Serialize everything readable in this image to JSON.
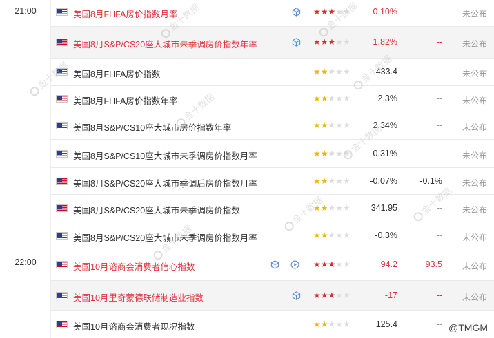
{
  "colors": {
    "highlight_red": "#e0303c",
    "star_red": "#d4302f",
    "star_yellow": "#e8b800",
    "star_off": "#dcdcdc",
    "row_border": "#e9e9e9",
    "shaded_row": "#f4f4f4"
  },
  "rows": [
    {
      "name": "美国8月FHFA房价指数月率",
      "importance": 3,
      "previous": "-0.10%",
      "forecast": "--",
      "actual": "未公布",
      "highlight": true,
      "icons": [
        "cube-icon"
      ]
    },
    {
      "name": "美国8月S&P/CS20座大城市未季调房价指数年率",
      "importance": 3,
      "previous": "1.82%",
      "forecast": "--",
      "actual": "未公布",
      "highlight": true,
      "icons": [
        "cube-icon"
      ]
    },
    {
      "name": "美国8月FHFA房价指数",
      "importance": 2,
      "previous": "433.4",
      "forecast": "--",
      "actual": "未公布",
      "highlight": false,
      "icons": []
    },
    {
      "name": "美国8月FHFA房价指数年率",
      "importance": 2,
      "previous": "2.3%",
      "forecast": "--",
      "actual": "未公布",
      "highlight": false,
      "icons": []
    },
    {
      "name": "美国8月S&P/CS10座大城市房价指数年率",
      "importance": 2,
      "previous": "2.34%",
      "forecast": "--",
      "actual": "未公布",
      "highlight": false,
      "icons": []
    },
    {
      "name": "美国8月S&P/CS10座大城市未季调房价指数月率",
      "importance": 2,
      "previous": "-0.31%",
      "forecast": "--",
      "actual": "未公布",
      "highlight": false,
      "icons": []
    },
    {
      "name": "美国8月S&P/CS20座大城市季调后房价指数月率",
      "importance": 2,
      "previous": "-0.07%",
      "forecast": "-0.1%",
      "actual": "未公布",
      "highlight": false,
      "icons": []
    },
    {
      "name": "美国8月S&P/CS20座大城市未季调房价指数",
      "importance": 2,
      "previous": "341.95",
      "forecast": "--",
      "actual": "未公布",
      "highlight": false,
      "icons": []
    },
    {
      "name": "美国8月S&P/CS20座大城市未季调房价指数月率",
      "importance": 2,
      "previous": "-0.3%",
      "forecast": "--",
      "actual": "未公布",
      "highlight": false,
      "icons": []
    },
    {
      "name": "美国10月谘商会消费者信心指数",
      "importance": 3,
      "previous": "94.2",
      "forecast": "93.5",
      "actual": "未公布",
      "highlight": true,
      "icons": [
        "cube-icon",
        "play-circle-icon"
      ]
    },
    {
      "name": "美国10月里奇蒙德联储制造业指数",
      "importance": 3,
      "previous": "-17",
      "forecast": "--",
      "actual": "未公布",
      "highlight": true,
      "icons": [
        "cube-icon"
      ]
    },
    {
      "name": "美国10月谘商会消费者现况指数",
      "importance": 2,
      "previous": "125.4",
      "forecast": "--",
      "actual": "未公布",
      "highlight": false,
      "icons": []
    }
  ],
  "groups": [
    {
      "time": "21:00"
    },
    {
      "time": "22:00"
    }
  ],
  "watermark": {
    "text": "金十数据"
  },
  "badge": {
    "text": "@TMGM"
  }
}
